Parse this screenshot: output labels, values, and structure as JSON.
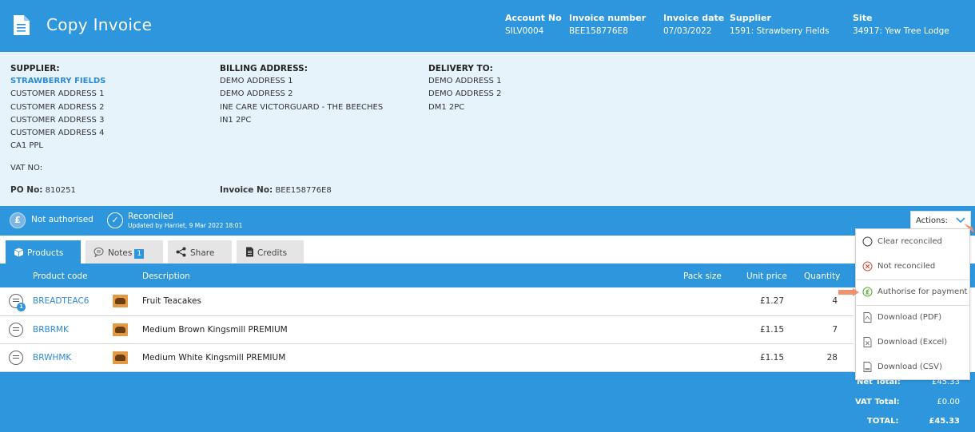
{
  "header": {
    "title": "Copy Invoice",
    "fields": [
      {
        "label": "Account No",
        "value": "SILV0004"
      },
      {
        "label": "Invoice number",
        "value": "BEE158776E8"
      },
      {
        "label": "Invoice date",
        "value": "07/03/2022"
      },
      {
        "label": "Supplier",
        "value": "1591: Strawberry Fields"
      },
      {
        "label": "Site",
        "value": "34917: Yew Tree Lodge"
      }
    ]
  },
  "supplier": {
    "heading": "SUPPLIER:",
    "name": "STRAWBERRY FIELDS",
    "lines": [
      "CUSTOMER ADDRESS 1",
      "CUSTOMER ADDRESS 2",
      "CUSTOMER ADDRESS 3",
      "CUSTOMER ADDRESS 4",
      "CA1 PPL"
    ],
    "vat_label": "VAT NO:",
    "po_label": "PO No:",
    "po_value": "810251"
  },
  "billing": {
    "heading": "BILLING ADDRESS:",
    "lines": [
      "DEMO ADDRESS 1",
      "DEMO ADDRESS 2",
      "INE CARE VICTORGUARD - THE BEECHES",
      "IN1 2PC"
    ],
    "invoice_label": "Invoice No:",
    "invoice_value": "BEE158776E8"
  },
  "delivery": {
    "heading": "DELIVERY TO:",
    "lines": [
      "DEMO ADDRESS 1",
      "DEMO ADDRESS 2",
      "DM1 2PC"
    ]
  },
  "status": {
    "auth_icon": "£",
    "auth": "Not authorised",
    "reconciled": "Reconciled",
    "updated": "Updated by Harriet, 9 Mar 2022 18:01",
    "actions_label": "Actions:"
  },
  "tabs": [
    {
      "label": "Products",
      "icon": "box-icon",
      "active": true
    },
    {
      "label": "Notes",
      "icon": "speech-icon",
      "badge": "1"
    },
    {
      "label": "Share",
      "icon": "share-icon"
    },
    {
      "label": "Credits",
      "icon": "document-icon"
    }
  ],
  "table": {
    "columns": [
      "Product code",
      "Description",
      "Pack size",
      "Unit price",
      "Quantity"
    ],
    "rows": [
      {
        "code": "BREADTEAC6",
        "description": "Fruit Teacakes",
        "unit_price": "£1.27",
        "quantity": "4",
        "note_count": "1"
      },
      {
        "code": "BRBRMK",
        "description": "Medium Brown Kingsmill PREMIUM",
        "unit_price": "£1.15",
        "quantity": "7"
      },
      {
        "code": "BRWHMK",
        "description": "Medium White Kingsmill PREMIUM",
        "unit_price": "£1.15",
        "quantity": "28"
      }
    ]
  },
  "totals": {
    "net_label": "Net Total:",
    "net_value": "£45.33",
    "vat_label": "VAT Total:",
    "vat_value": "£0.00",
    "total_label": "TOTAL:",
    "total_value": "£45.33"
  },
  "actions_menu": [
    {
      "label": "Clear reconciled",
      "icon": "circle-icon"
    },
    {
      "label": "Not reconciled",
      "icon": "x-circle-icon"
    },
    {
      "label": "Authorise for payment",
      "icon": "pound-circle-icon"
    },
    {
      "label": "Download (PDF)",
      "icon": "pdf-file-icon"
    },
    {
      "label": "Download (Excel)",
      "icon": "excel-file-icon"
    },
    {
      "label": "Download (CSV)",
      "icon": "csv-file-icon"
    }
  ],
  "colors": {
    "brand": "#2d96dc",
    "panel": "#e6f3fb",
    "link": "#2d8ad6",
    "pointer": "#f0926d"
  }
}
